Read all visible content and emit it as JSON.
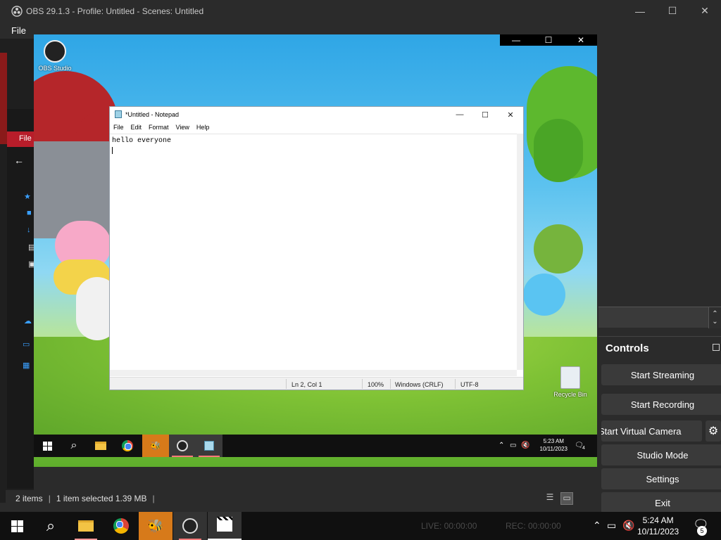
{
  "obs": {
    "title": "OBS 29.1.3 - Profile: Untitled - Scenes: Untitled",
    "menu_file": "File",
    "min": "—",
    "max": "☐",
    "close": "✕"
  },
  "explorer_bg": {
    "file_tab": "File",
    "back_arrow": "←",
    "status_items": "2 items",
    "status_selected": "1 item selected  1.39 MB"
  },
  "preview": {
    "desktop_icon_obs": "OBS Studio",
    "desktop_icon_recycle": "Recycle Bin",
    "inner_min": "—",
    "inner_max": "☐",
    "inner_close": "✕"
  },
  "notepad": {
    "title": "*Untitled - Notepad",
    "menu": [
      "File",
      "Edit",
      "Format",
      "View",
      "Help"
    ],
    "content": "hello everyone",
    "status_pos": "Ln 2, Col 1",
    "status_zoom": "100%",
    "status_eol": "Windows (CRLF)",
    "status_enc": "UTF-8",
    "min": "—",
    "max": "☐",
    "close": "✕"
  },
  "inner_taskbar": {
    "time": "5:23 AM",
    "date": "10/11/2023",
    "notif_count": "4"
  },
  "controls": {
    "header": "Controls",
    "start_streaming": "Start Streaming",
    "start_recording": "Start Recording",
    "start_virtual_camera": "Start Virtual Camera",
    "studio_mode": "Studio Mode",
    "settings": "Settings",
    "exit": "Exit"
  },
  "main_taskbar": {
    "live": "LIVE: 00:00:00",
    "rec": "REC: 00:00:00",
    "time": "5:24 AM",
    "date": "10/11/2023",
    "notif_count": "5"
  },
  "colors": {
    "obs_bg": "#2b2b2b",
    "button_bg": "#3a3a3a",
    "taskbar": "#101010",
    "accent_red": "#b81d2a",
    "accent_orange": "#d77a1a"
  }
}
